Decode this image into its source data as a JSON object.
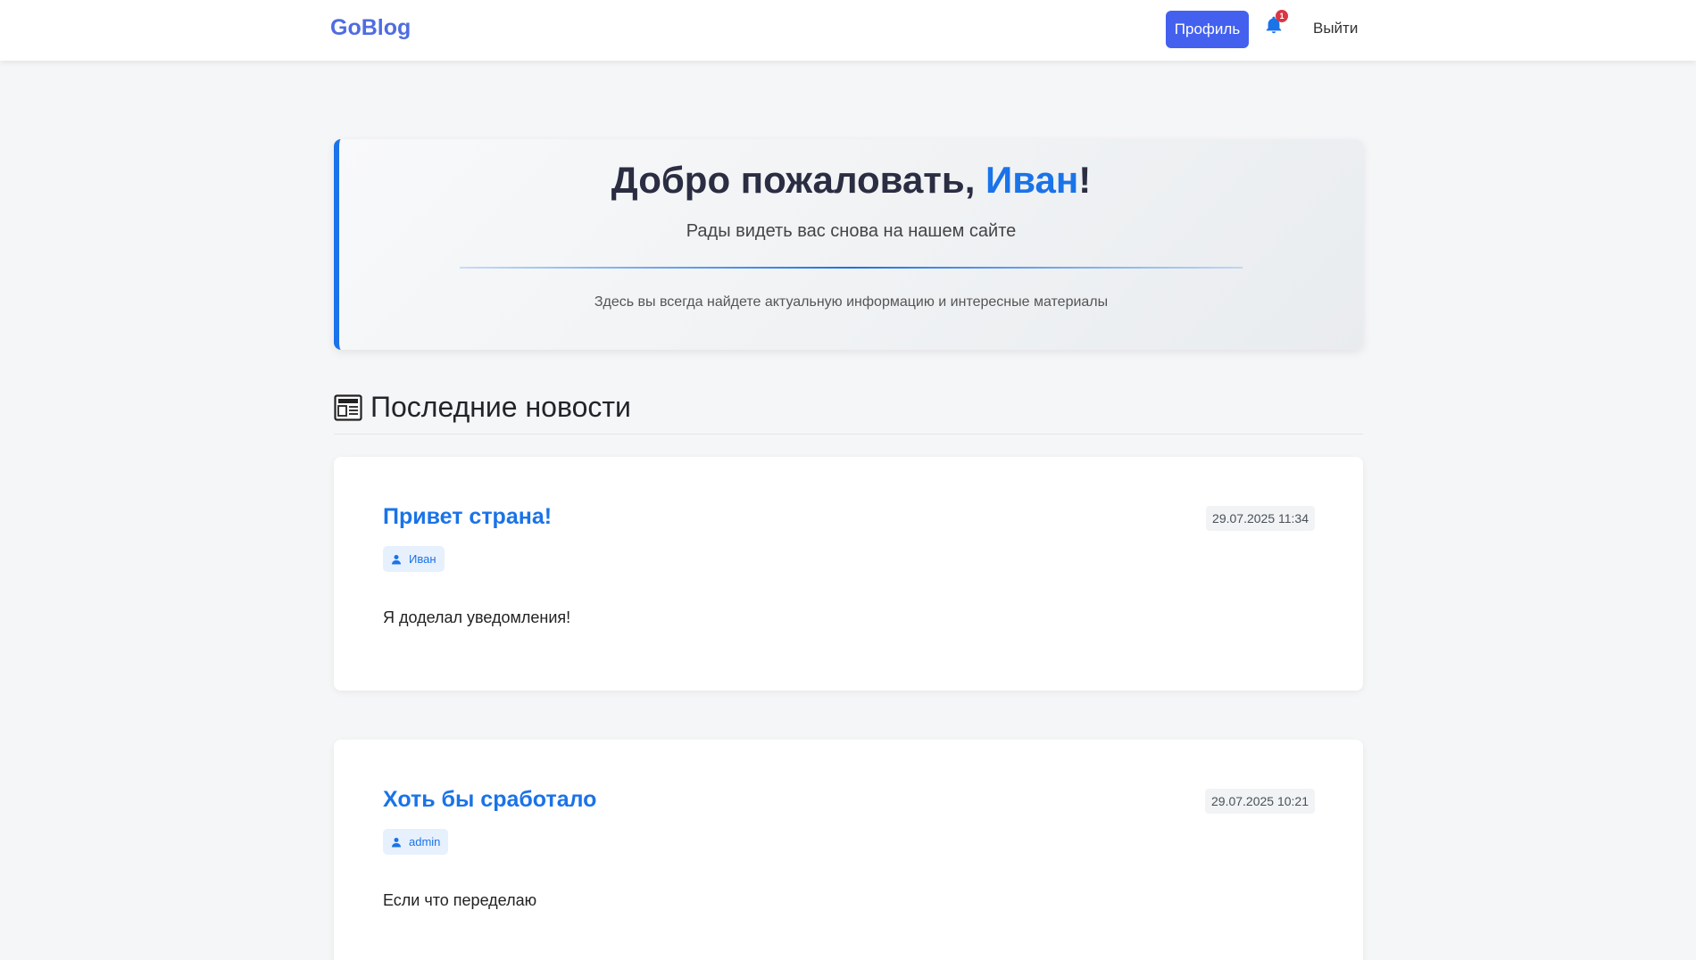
{
  "header": {
    "brand": "GoBlog",
    "profile_label": "Профиль",
    "notification_count": "1",
    "logout_label": "Выйти",
    "accent_color": "#4361ee"
  },
  "welcome": {
    "greeting": "Добро пожаловать, ",
    "username": "Иван",
    "exclamation": "!",
    "subtitle": "Рады видеть вас снова на нашем сайте",
    "note": "Здесь вы всегда найдете актуальную информацию и интересные материалы"
  },
  "news": {
    "section_icon": "newspaper-icon",
    "section_title": "Последние новости",
    "posts": [
      {
        "title": "Привет страна!",
        "date": "29.07.2025 11:34",
        "author": "Иван",
        "body": "Я доделал уведомления!"
      },
      {
        "title": "Хоть бы сработало",
        "date": "29.07.2025 10:21",
        "author": "admin",
        "body": "Если что переделаю"
      }
    ]
  }
}
